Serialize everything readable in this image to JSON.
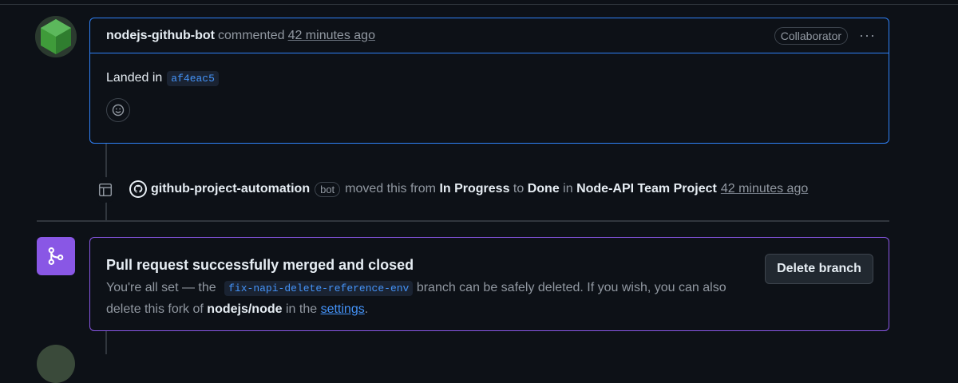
{
  "comment": {
    "author": "nodejs-github-bot",
    "verb": "commented",
    "time": "42 minutes ago",
    "badge": "Collaborator",
    "menu": "···",
    "body_prefix": "Landed in",
    "commit": "af4eac5"
  },
  "event": {
    "actor": "github-project-automation",
    "bot_label": "bot",
    "text_moved": "moved this from",
    "from": "In Progress",
    "to_word": "to",
    "to": "Done",
    "in_word": "in",
    "project": "Node-API Team Project",
    "time": "42 minutes ago"
  },
  "merge": {
    "title": "Pull request successfully merged and closed",
    "desc_1": "You're all set — the",
    "branch": "fix-napi-delete-reference-env",
    "desc_2": "branch can be safely deleted. If you wish, you can also delete this fork of",
    "repo": "nodejs/node",
    "desc_3": "in the",
    "settings_link": "settings",
    "desc_end": ".",
    "delete_button": "Delete branch"
  },
  "colors": {
    "accent_blue": "#2f81f7",
    "merged_purple": "#8957e5",
    "background": "#0d1117"
  }
}
